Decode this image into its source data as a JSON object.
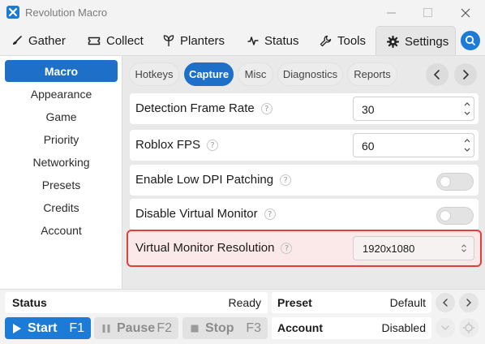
{
  "window": {
    "title": "Revolution Macro"
  },
  "topnav": {
    "tabs": [
      {
        "label": "Gather",
        "icon": "broom-icon"
      },
      {
        "label": "Collect",
        "icon": "ticket-icon"
      },
      {
        "label": "Planters",
        "icon": "sprout-icon"
      },
      {
        "label": "Status",
        "icon": "pulse-icon"
      },
      {
        "label": "Tools",
        "icon": "wrench-icon"
      },
      {
        "label": "Settings",
        "icon": "gear-icon",
        "active": true
      }
    ],
    "search_icon": "search-icon"
  },
  "sidebar": {
    "items": [
      {
        "label": "Macro",
        "active": true
      },
      {
        "label": "Appearance"
      },
      {
        "label": "Game"
      },
      {
        "label": "Priority"
      },
      {
        "label": "Networking"
      },
      {
        "label": "Presets"
      },
      {
        "label": "Credits"
      },
      {
        "label": "Account"
      }
    ]
  },
  "subtabs": {
    "items": [
      {
        "label": "Hotkeys"
      },
      {
        "label": "Capture",
        "active": true
      },
      {
        "label": "Misc"
      },
      {
        "label": "Diagnostics"
      },
      {
        "label": "Reports"
      }
    ]
  },
  "settings": {
    "detection_frame_rate": {
      "label": "Detection Frame Rate",
      "value": "30"
    },
    "roblox_fps": {
      "label": "Roblox FPS",
      "value": "60"
    },
    "low_dpi": {
      "label": "Enable Low DPI Patching",
      "enabled": false
    },
    "disable_virtual_monitor": {
      "label": "Disable Virtual Monitor",
      "enabled": false
    },
    "virtual_monitor_resolution": {
      "label": "Virtual Monitor Resolution",
      "value": "1920x1080"
    },
    "help_glyph": "?"
  },
  "statusbar": {
    "status_key": "Status",
    "status_value": "Ready",
    "preset_key": "Preset",
    "preset_value": "Default",
    "account_key": "Account",
    "account_value": "Disabled",
    "start": {
      "label": "Start",
      "hotkey": "F1"
    },
    "pause": {
      "label": "Pause",
      "hotkey": "F2"
    },
    "stop": {
      "label": "Stop",
      "hotkey": "F3"
    }
  },
  "colors": {
    "accent": "#1d7bd8",
    "highlight_border": "#e0403a",
    "highlight_bg": "#fbe9e9"
  }
}
